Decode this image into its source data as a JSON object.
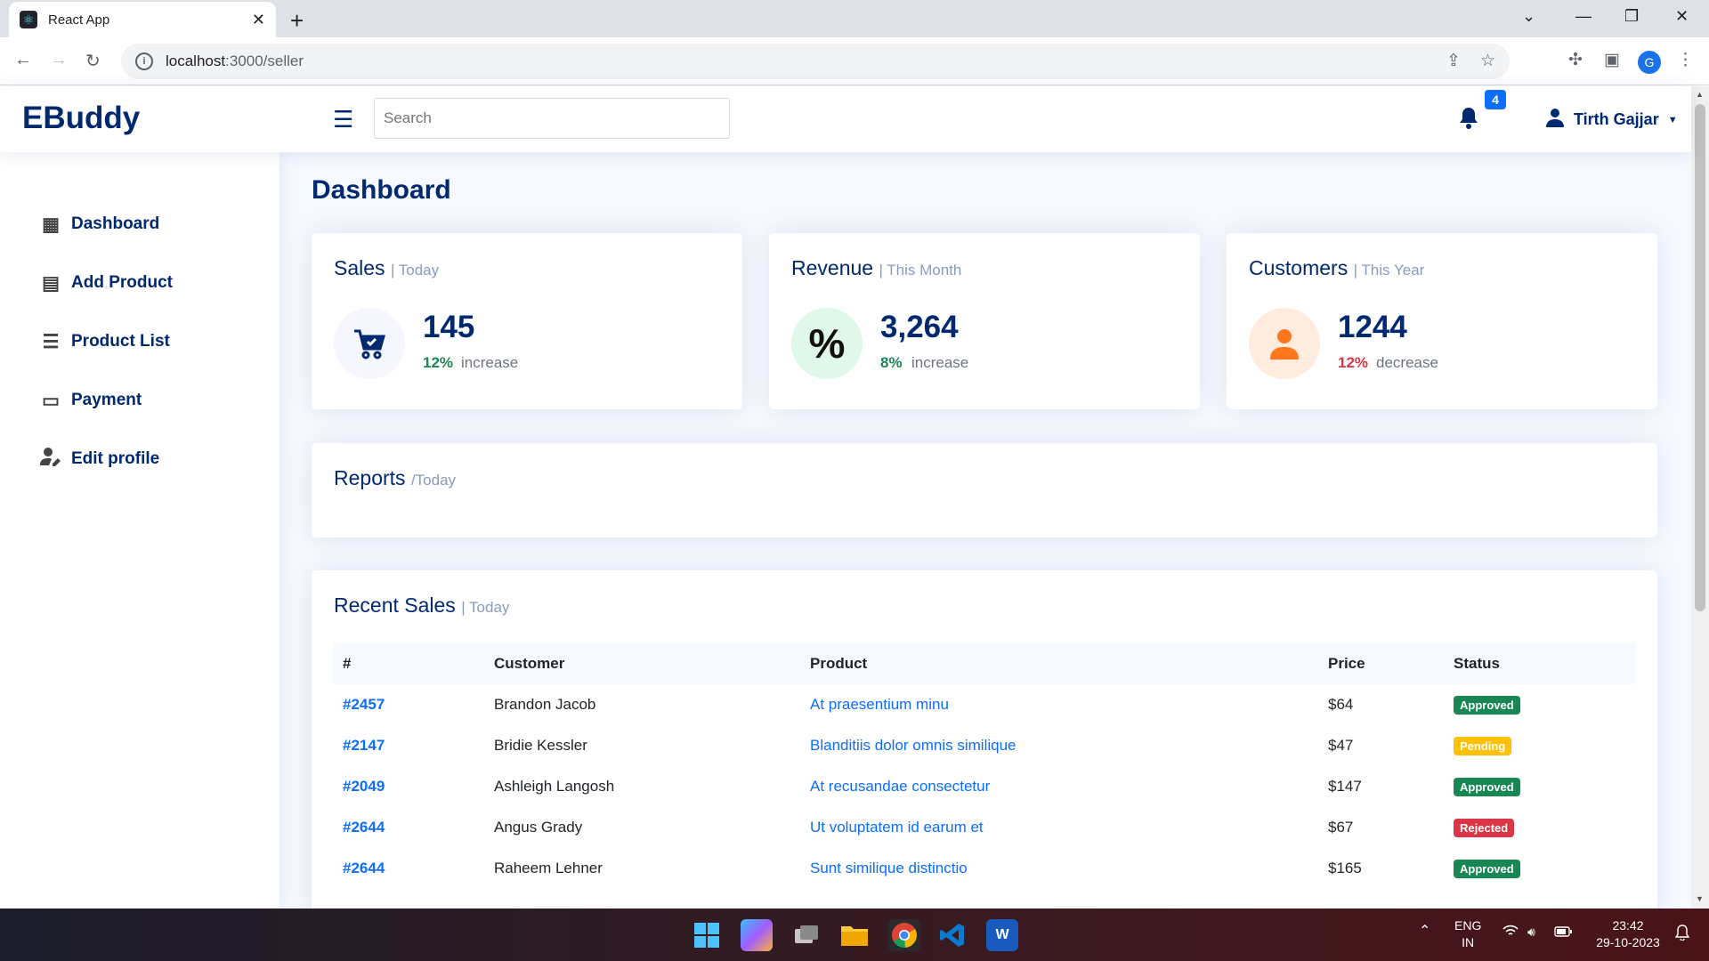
{
  "browser": {
    "tab_title": "React App",
    "url_host": "localhost",
    "url_path": ":3000/seller",
    "profile_initial": "G"
  },
  "header": {
    "brand": "EBuddy",
    "search_placeholder": "Search",
    "notification_count": "4",
    "user_name": "Tirth Gajjar"
  },
  "sidebar": {
    "items": [
      {
        "label": "Dashboard",
        "icon": "grid-icon"
      },
      {
        "label": "Add Product",
        "icon": "file-plus-icon"
      },
      {
        "label": "Product List",
        "icon": "list-icon"
      },
      {
        "label": "Payment",
        "icon": "credit-card-icon"
      },
      {
        "label": "Edit profile",
        "icon": "user-edit-icon"
      }
    ]
  },
  "main": {
    "title": "Dashboard",
    "cards": [
      {
        "title": "Sales",
        "period": "| Today",
        "value": "145",
        "pct": "12%",
        "trend": "increase",
        "icon": "cart-icon"
      },
      {
        "title": "Revenue",
        "period": "| This Month",
        "value": "3,264",
        "pct": "8%",
        "trend": "increase",
        "icon": "percent-icon"
      },
      {
        "title": "Customers",
        "period": "| This Year",
        "value": "1244",
        "pct": "12%",
        "trend": "decrease",
        "icon": "person-icon"
      }
    ],
    "reports": {
      "title": "Reports",
      "period": "/Today"
    },
    "recent_sales": {
      "title": "Recent Sales",
      "period": "| Today",
      "columns": [
        "#",
        "Customer",
        "Product",
        "Price",
        "Status"
      ],
      "rows": [
        {
          "id": "#2457",
          "customer": "Brandon Jacob",
          "product": "At praesentium minu",
          "price": "$64",
          "status": "Approved"
        },
        {
          "id": "#2147",
          "customer": "Bridie Kessler",
          "product": "Blanditiis dolor omnis similique",
          "price": "$47",
          "status": "Pending"
        },
        {
          "id": "#2049",
          "customer": "Ashleigh Langosh",
          "product": "At recusandae consectetur",
          "price": "$147",
          "status": "Approved"
        },
        {
          "id": "#2644",
          "customer": "Angus Grady",
          "product": "Ut voluptatem id earum et",
          "price": "$67",
          "status": "Rejected"
        },
        {
          "id": "#2644",
          "customer": "Raheem Lehner",
          "product": "Sunt similique distinctio",
          "price": "$165",
          "status": "Approved"
        }
      ]
    }
  },
  "taskbar": {
    "lang": "ENG",
    "region": "IN",
    "time": "23:42",
    "date": "29-10-2023"
  },
  "colors": {
    "brand": "#012970",
    "accent": "#0d6efd",
    "success": "#198754",
    "warning": "#ffc107",
    "danger": "#dc3545"
  }
}
